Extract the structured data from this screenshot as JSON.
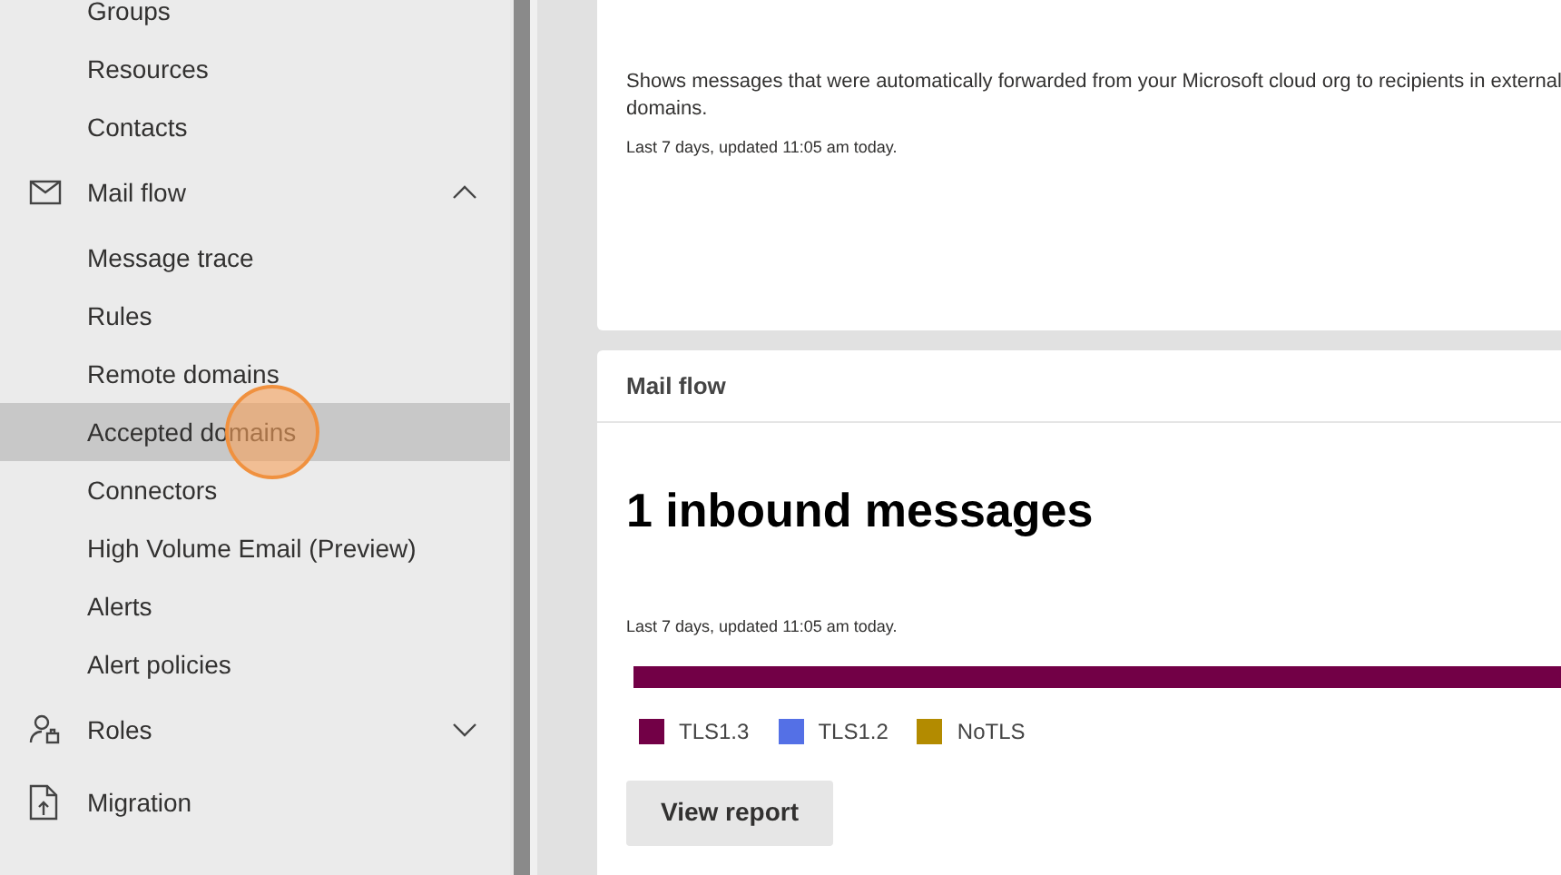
{
  "sidebar": {
    "items": [
      {
        "kind": "sub",
        "label": "Groups",
        "selected": false
      },
      {
        "kind": "sub",
        "label": "Resources",
        "selected": false
      },
      {
        "kind": "sub",
        "label": "Contacts",
        "selected": false
      },
      {
        "kind": "top",
        "label": "Mail flow",
        "expanded": true
      },
      {
        "kind": "sub",
        "label": "Message trace",
        "selected": false
      },
      {
        "kind": "sub",
        "label": "Rules",
        "selected": false
      },
      {
        "kind": "sub",
        "label": "Remote domains",
        "selected": false
      },
      {
        "kind": "sub",
        "label": "Accepted domains",
        "selected": true
      },
      {
        "kind": "sub",
        "label": "Connectors",
        "selected": false
      },
      {
        "kind": "sub",
        "label": "High Volume Email (Preview)",
        "selected": false
      },
      {
        "kind": "sub",
        "label": "Alerts",
        "selected": false
      },
      {
        "kind": "sub",
        "label": "Alert policies",
        "selected": false
      },
      {
        "kind": "top",
        "label": "Roles",
        "expanded": false
      },
      {
        "kind": "top",
        "label": "Migration"
      }
    ]
  },
  "cards": [
    {
      "description": "Shows messages that were automatically forwarded from your Microsoft cloud org to recipients in external domains.",
      "updated": "Last 7 days, updated 11:05 am today."
    },
    {
      "title": "Mail flow",
      "headline": "1 inbound messages",
      "updated": "Last 7 days, updated 11:05 am today.",
      "legend": [
        {
          "label": "TLS1.3",
          "color": "#720046"
        },
        {
          "label": "TLS1.2",
          "color": "#5470e6"
        },
        {
          "label": "NoTLS",
          "color": "#b38b00"
        }
      ],
      "button": "View report"
    }
  ]
}
